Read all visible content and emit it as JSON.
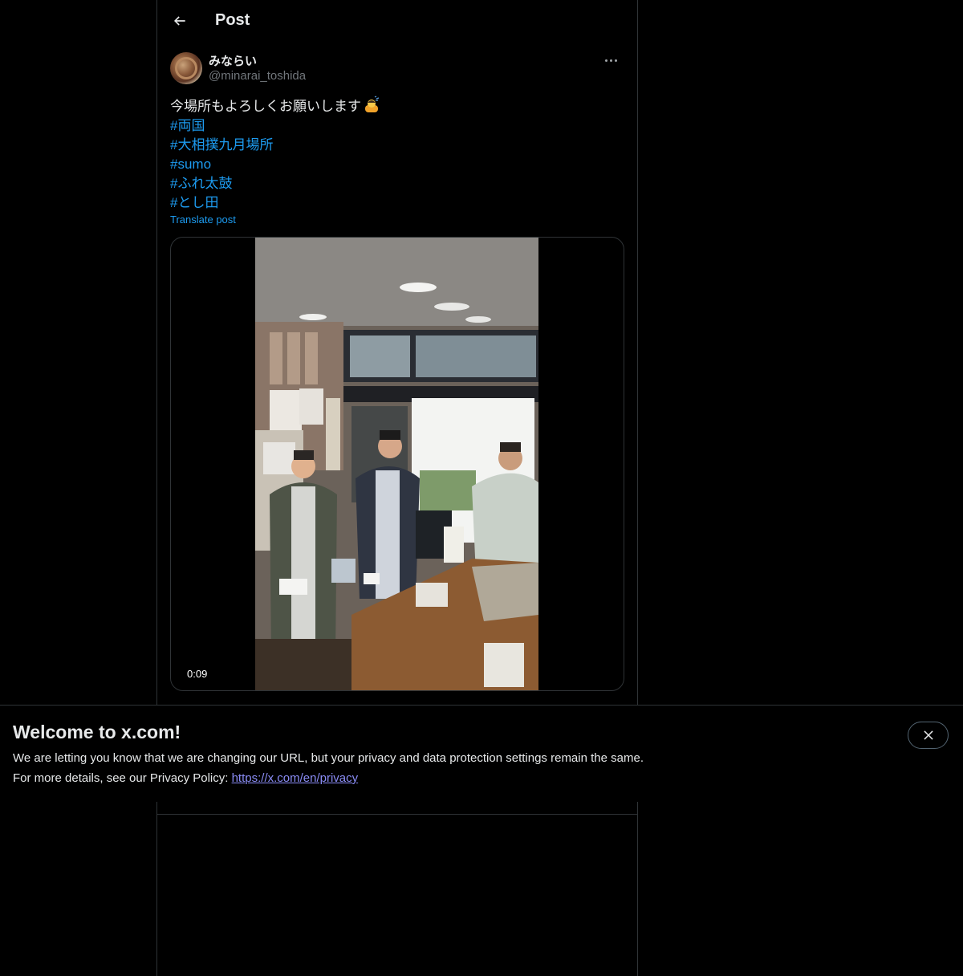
{
  "header": {
    "title": "Post",
    "back_icon": "arrow-left-icon"
  },
  "post": {
    "author": {
      "display_name": "みならい",
      "handle": "@minarai_toshida"
    },
    "text": "今場所もよろしくお願いします",
    "emoji": "person-bowing-emoji",
    "hashtags": [
      "#両国",
      "#大相撲九月場所",
      "#sumo",
      "#ふれ太鼓",
      "#とし田"
    ],
    "translate_label": "Translate post",
    "video": {
      "duration": "0:09"
    }
  },
  "banner": {
    "title": "Welcome to x.com!",
    "line1": "We are letting you know that we are changing our URL, but your privacy and data protection settings remain the same.",
    "line2_prefix": "For more details, see our Privacy Policy: ",
    "privacy_link": "https://x.com/en/privacy",
    "close_icon": "close-icon"
  },
  "colors": {
    "background": "#000000",
    "text": "#e7e9ea",
    "secondary_text": "#71767b",
    "link": "#1d9bf0",
    "border": "#2f3336"
  }
}
